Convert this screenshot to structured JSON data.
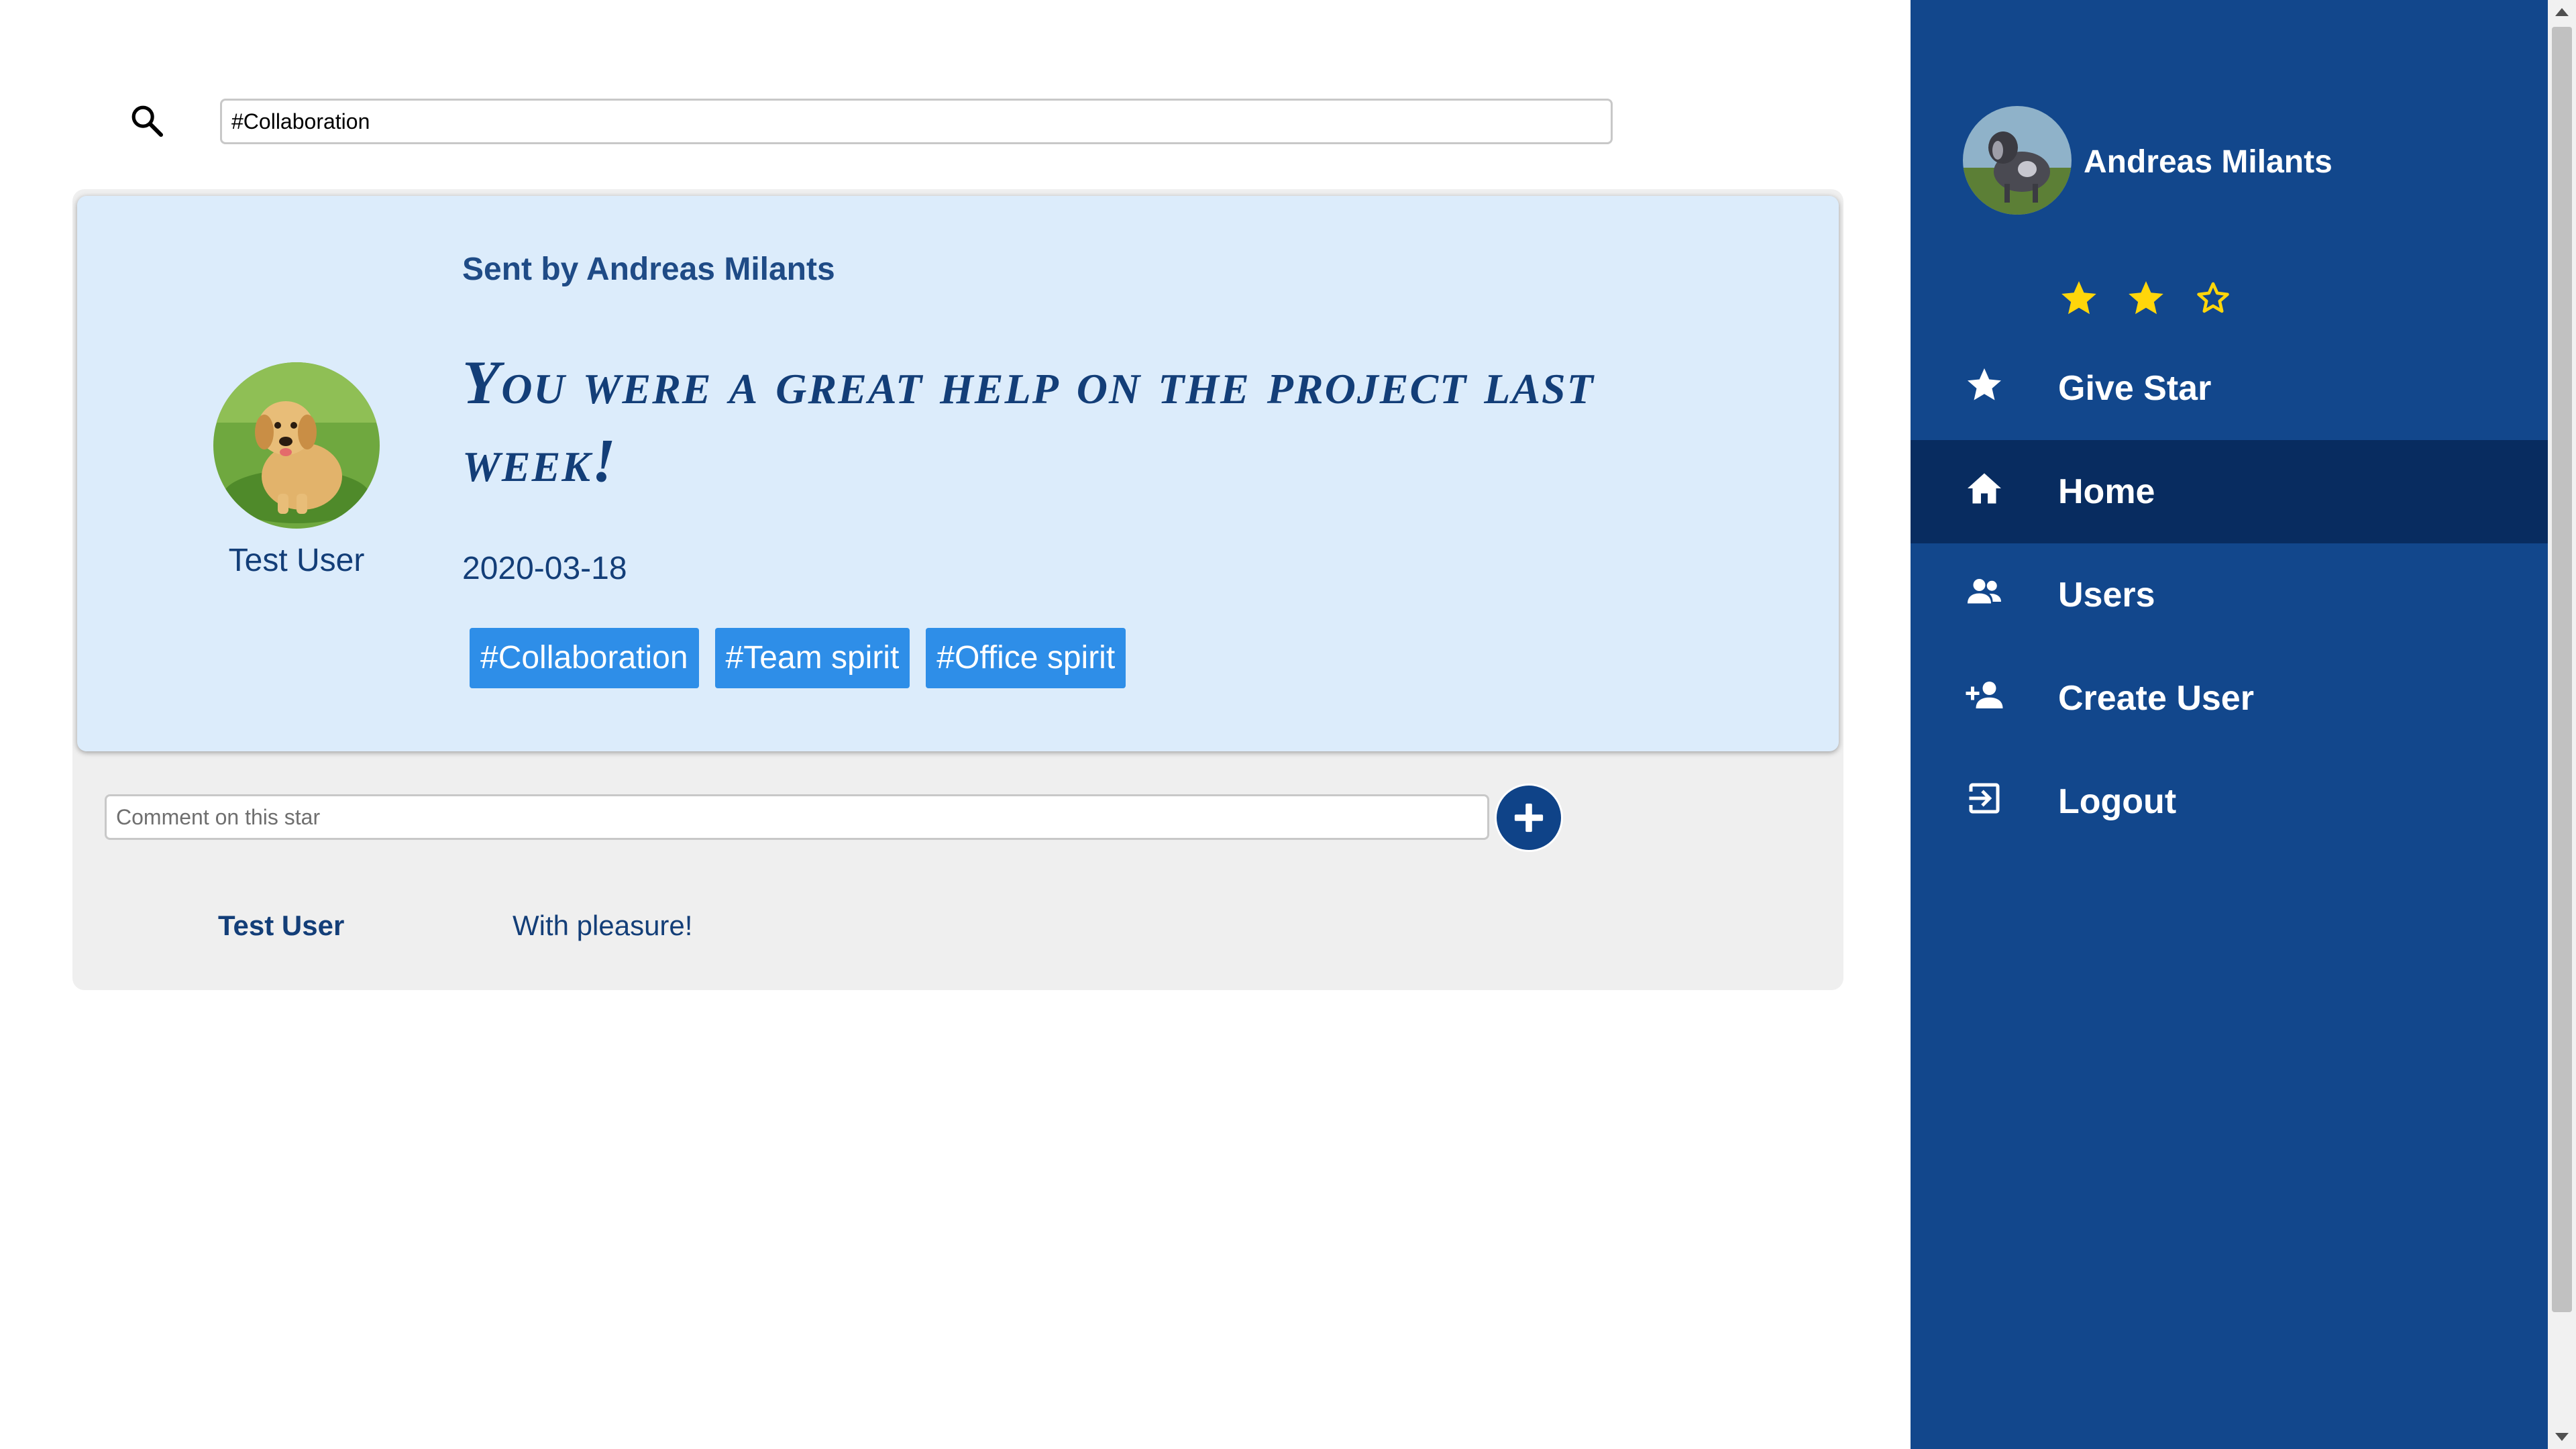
{
  "search": {
    "value": "#Collaboration",
    "icon": "search-icon"
  },
  "star": {
    "sent_by": "Sent by Andreas Milants",
    "receiver_name": "Test User",
    "message": "You were a great help on the project last week!",
    "date": "2020-03-18",
    "tags": [
      "#Collaboration",
      "#Team spirit",
      "#Office spirit"
    ]
  },
  "comment": {
    "placeholder": "Comment on this star",
    "add_icon": "plus-icon",
    "items": [
      {
        "author": "Test User",
        "text": "With pleasure!"
      }
    ]
  },
  "sidebar": {
    "profile_name": "Andreas Milants",
    "rating": {
      "filled": 2,
      "total": 3
    },
    "items": [
      {
        "label": "Give Star",
        "icon": "star-icon",
        "active": false
      },
      {
        "label": "Home",
        "icon": "home-icon",
        "active": true
      },
      {
        "label": "Users",
        "icon": "users-icon",
        "active": false
      },
      {
        "label": "Create User",
        "icon": "add-user-icon",
        "active": false
      },
      {
        "label": "Logout",
        "icon": "logout-icon",
        "active": false
      }
    ]
  },
  "colors": {
    "sidebar_bg": "#12478c",
    "sidebar_active": "#082c60",
    "card_bg": "#dcecfb",
    "tag_bg": "#2e8ee8",
    "text_primary": "#133e78",
    "star_gold": "#ffd60a"
  }
}
